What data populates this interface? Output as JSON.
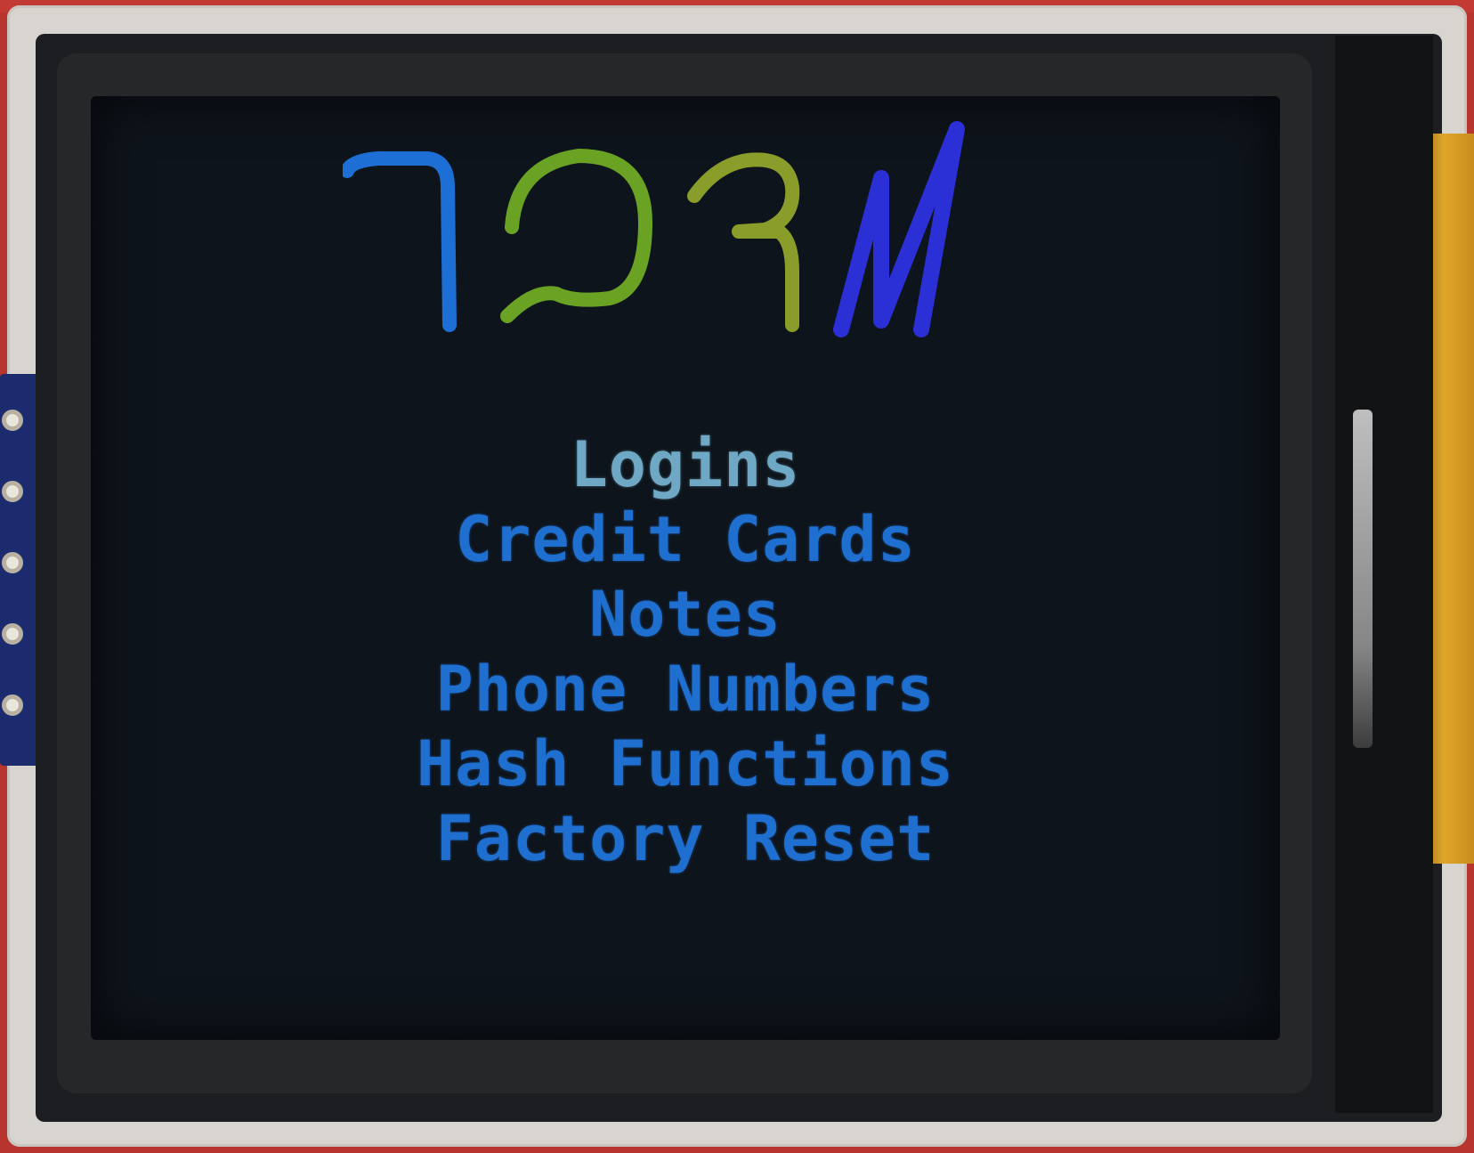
{
  "device": {
    "logo_glyphs": [
      "7",
      "Ω",
      "3",
      "N"
    ],
    "logo_colors": [
      "#1d6fd6",
      "#6aa323",
      "#8a9c2a",
      "#2b2fd6"
    ]
  },
  "menu": {
    "items": [
      {
        "label": "Logins",
        "selected": true
      },
      {
        "label": "Credit Cards",
        "selected": false
      },
      {
        "label": "Notes",
        "selected": false
      },
      {
        "label": "Phone Numbers",
        "selected": false
      },
      {
        "label": "Hash Functions",
        "selected": false
      },
      {
        "label": "Factory Reset",
        "selected": false
      }
    ],
    "selected_color": "#6fa8c4",
    "item_color": "#1e6fd0"
  }
}
